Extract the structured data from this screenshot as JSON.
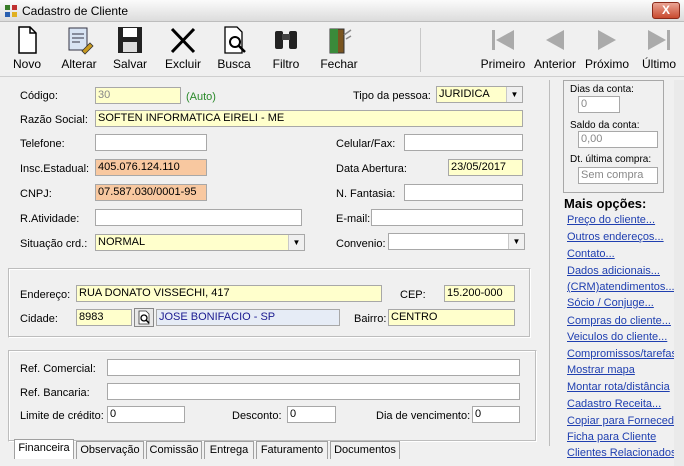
{
  "window": {
    "title": "Cadastro de Cliente",
    "close": "X"
  },
  "toolbar": {
    "novo": "Novo",
    "alterar": "Alterar",
    "salvar": "Salvar",
    "excluir": "Excluir",
    "busca": "Busca",
    "filtro": "Filtro",
    "fechar": "Fechar",
    "primeiro": "Primeiro",
    "anterior": "Anterior",
    "proximo": "Próximo",
    "ultimo": "Último"
  },
  "form": {
    "codigo_label": "Código:",
    "codigo": "30",
    "auto": "(Auto)",
    "tipo_label": "Tipo da pessoa:",
    "tipo": "JURIDICA",
    "razao_label": "Razão Social:",
    "razao": "SOFTEN INFORMATICA EIRELI - ME",
    "telefone_label": "Telefone:",
    "telefone": "",
    "celular_label": "Celular/Fax:",
    "celular": "",
    "insc_label": "Insc.Estadual:",
    "insc": "405.076.124.110",
    "abertura_label": "Data Abertura:",
    "abertura": "23/05/2017",
    "cnpj_label": "CNPJ:",
    "cnpj": "07.587.030/0001-95",
    "fantasia_label": "N. Fantasia:",
    "fantasia": "",
    "atividade_label": "R.Atividade:",
    "atividade": "",
    "email_label": "E-mail:",
    "email": "",
    "situacao_label": "Situação crd.:",
    "situacao": "NORMAL",
    "convenio_label": "Convenio:",
    "convenio": ""
  },
  "address": {
    "endereco_label": "Endereço:",
    "endereco": "RUA DONATO VISSECHI, 417",
    "cep_label": "CEP:",
    "cep": "15.200-000",
    "cidade_label": "Cidade:",
    "cidade_code": "8983",
    "cidade": "JOSE BONIFACIO - SP",
    "bairro_label": "Bairro:",
    "bairro": "CENTRO"
  },
  "financeira": {
    "ref_comercial_label": "Ref. Comercial:",
    "ref_comercial": "",
    "ref_bancaria_label": "Ref. Bancaria:",
    "ref_bancaria": "",
    "limite_label": "Limite de crédito:",
    "limite": "0",
    "desconto_label": "Desconto:",
    "desconto": "0",
    "vencimento_label": "Dia de vencimento:",
    "vencimento": "0"
  },
  "tabs": [
    "Financeira",
    "Observação",
    "Comissão",
    "Entrega",
    "Faturamento",
    "Documentos"
  ],
  "side": {
    "dias_label": "Dias da conta:",
    "dias": "0",
    "saldo_label": "Saldo da conta:",
    "saldo": "0,00",
    "ultima_label": "Dt. última compra:",
    "ultima": "Sem compra"
  },
  "mais": {
    "title": "Mais opções:",
    "links": [
      "Preço do cliente...",
      "Outros endereços...",
      "Contato...",
      "Dados adicionais...",
      "(CRM)atendimentos...",
      "Sócio / Conjuge...",
      "Compras do cliente...",
      "Veiculos do cliente...",
      "Compromissos/tarefas",
      "Mostrar mapa",
      "Montar rota/distância",
      "Cadastro Receita...",
      "Copiar para Fornecedor",
      "Ficha para Cliente",
      "Clientes Relacionados"
    ]
  },
  "colors": {
    "yellow": "#ffffcc",
    "orange": "#f8c8a0",
    "link": "#1f3fb0"
  }
}
